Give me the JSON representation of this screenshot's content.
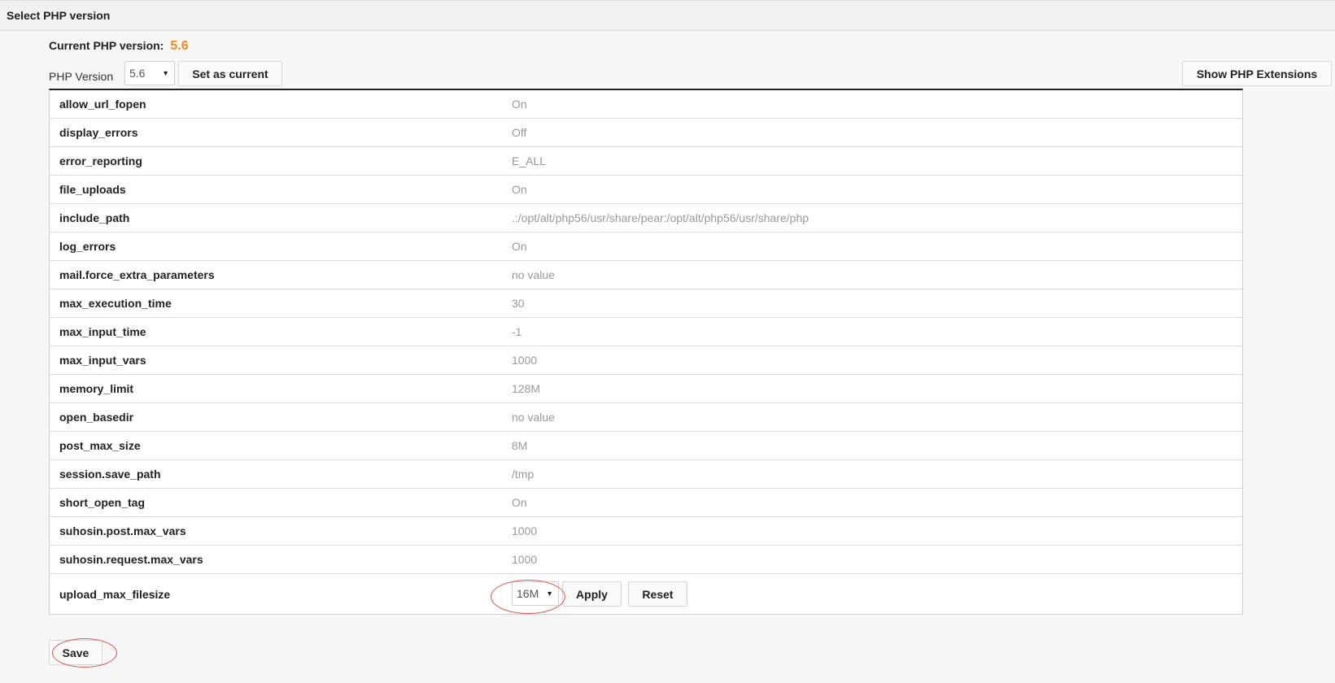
{
  "header": {
    "title": "Select PHP version"
  },
  "current_version": {
    "label": "Current PHP version:",
    "value": "5.6"
  },
  "version_select": {
    "label": "PHP Version",
    "selected": "5.6"
  },
  "buttons": {
    "set_current": "Set as current",
    "show_extensions": "Show PHP Extensions",
    "apply": "Apply",
    "reset": "Reset",
    "save": "Save"
  },
  "options": [
    {
      "name": "allow_url_fopen",
      "value": "On"
    },
    {
      "name": "display_errors",
      "value": "Off"
    },
    {
      "name": "error_reporting",
      "value": "E_ALL"
    },
    {
      "name": "file_uploads",
      "value": "On"
    },
    {
      "name": "include_path",
      "value": ".:/opt/alt/php56/usr/share/pear:/opt/alt/php56/usr/share/php"
    },
    {
      "name": "log_errors",
      "value": "On"
    },
    {
      "name": "mail.force_extra_parameters",
      "value": "no value"
    },
    {
      "name": "max_execution_time",
      "value": "30"
    },
    {
      "name": "max_input_time",
      "value": "-1"
    },
    {
      "name": "max_input_vars",
      "value": "1000"
    },
    {
      "name": "memory_limit",
      "value": "128M"
    },
    {
      "name": "open_basedir",
      "value": "no value"
    },
    {
      "name": "post_max_size",
      "value": "8M"
    },
    {
      "name": "session.save_path",
      "value": "/tmp"
    },
    {
      "name": "short_open_tag",
      "value": "On"
    },
    {
      "name": "suhosin.post.max_vars",
      "value": "1000"
    },
    {
      "name": "suhosin.request.max_vars",
      "value": "1000"
    }
  ],
  "upload_row": {
    "name": "upload_max_filesize",
    "selected": "16M"
  },
  "colors": {
    "accent": "#f08a24",
    "annotation": "#d9534f"
  }
}
